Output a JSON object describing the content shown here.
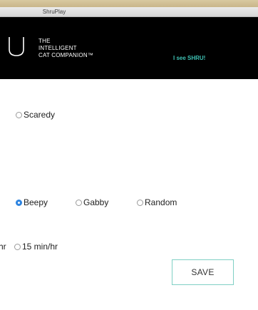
{
  "window": {
    "title": "ShruPlay"
  },
  "header": {
    "logo_lines": [
      "THE",
      "INTELLIGENT",
      "CAT COMPANION™"
    ],
    "link_text": "I see SHRU!"
  },
  "personality": {
    "options": [
      {
        "label": "Scaredy",
        "checked": false
      }
    ]
  },
  "sound": {
    "options": [
      {
        "label": "Beepy",
        "checked": true
      },
      {
        "label": "Gabby",
        "checked": false
      },
      {
        "label": "Random",
        "checked": false
      }
    ]
  },
  "frequency": {
    "clipped_label": "hr",
    "options": [
      {
        "label": "15 min/hr",
        "checked": false
      }
    ]
  },
  "actions": {
    "save_label": "SAVE"
  },
  "colors": {
    "header_bg": "#000000",
    "link": "#3ec2b4",
    "radio_checked": "#2e84e0",
    "button_border": "#7fd0c4"
  },
  "icons": {
    "logo": "u-logo-icon"
  }
}
